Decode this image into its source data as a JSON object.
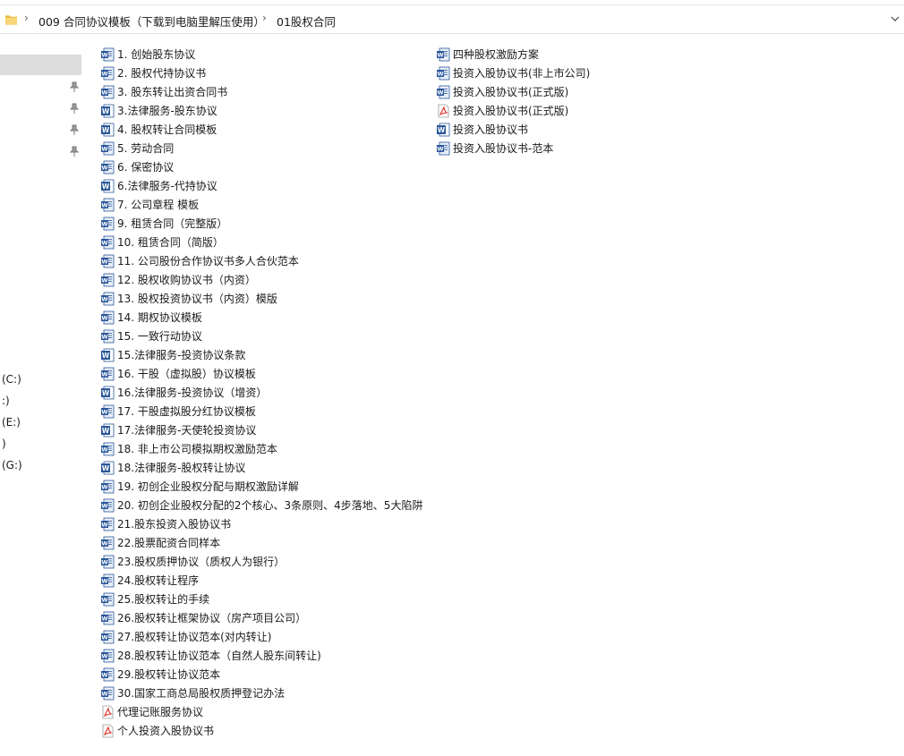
{
  "addressbar": {
    "crumbs": [
      "009 合同协议模板（下载到电脑里解压使用）",
      "01股权合同"
    ]
  },
  "navpane": {
    "drives": [
      "(C:)",
      ":)",
      "(E:)",
      ")",
      "(G:)"
    ]
  },
  "files_col1": [
    {
      "name": "1. 创始股东协议",
      "type": "doc"
    },
    {
      "name": "2. 股权代持协议书",
      "type": "doc"
    },
    {
      "name": "3. 股东转让出资合同书",
      "type": "doc"
    },
    {
      "name": "3.法律服务-股东协议",
      "type": "docx"
    },
    {
      "name": "4. 股权转让合同模板",
      "type": "docx"
    },
    {
      "name": "5. 劳动合同",
      "type": "doc"
    },
    {
      "name": "6. 保密协议",
      "type": "doc"
    },
    {
      "name": "6.法律服务-代持协议",
      "type": "docx"
    },
    {
      "name": "7. 公司章程 模板",
      "type": "doc"
    },
    {
      "name": "9. 租赁合同（完整版）",
      "type": "doc"
    },
    {
      "name": "10. 租赁合同（简版）",
      "type": "doc"
    },
    {
      "name": "11. 公司股份合作协议书多人合伙范本",
      "type": "doc"
    },
    {
      "name": "12. 股权收购协议书（内资）",
      "type": "doc"
    },
    {
      "name": "13. 股权投资协议书（内资）模版",
      "type": "doc"
    },
    {
      "name": "14. 期权协议模板",
      "type": "doc"
    },
    {
      "name": "15. 一致行动协议",
      "type": "doc"
    },
    {
      "name": "15.法律服务-投资协议条款",
      "type": "docx"
    },
    {
      "name": "16. 干股（虚拟股）协议模板",
      "type": "doc"
    },
    {
      "name": "16.法律服务-投资协议（增资）",
      "type": "docx"
    },
    {
      "name": "17. 干股虚拟股分红协议模板",
      "type": "doc"
    },
    {
      "name": "17.法律服务-天使轮投资协议",
      "type": "docx"
    },
    {
      "name": "18. 非上市公司模拟期权激励范本",
      "type": "doc"
    },
    {
      "name": "18.法律服务-股权转让协议",
      "type": "docx"
    },
    {
      "name": "19. 初创企业股权分配与期权激励详解",
      "type": "doc"
    },
    {
      "name": "20. 初创企业股权分配的2个核心、3条原则、4步落地、5大陷阱",
      "type": "doc"
    },
    {
      "name": "21.股东投资入股协议书",
      "type": "doc"
    },
    {
      "name": "22.股票配资合同样本",
      "type": "doc"
    },
    {
      "name": "23.股权质押协议（质权人为银行）",
      "type": "doc"
    },
    {
      "name": "24.股权转让程序",
      "type": "doc"
    },
    {
      "name": "25.股权转让的手续",
      "type": "doc"
    },
    {
      "name": "26.股权转让框架协议（房产项目公司）",
      "type": "doc"
    },
    {
      "name": "27.股权转让协议范本(对内转让)",
      "type": "doc"
    },
    {
      "name": "28.股权转让协议范本（自然人股东间转让)",
      "type": "doc"
    },
    {
      "name": "29.股权转让协议范本",
      "type": "doc"
    },
    {
      "name": "30.国家工商总局股权质押登记办法",
      "type": "doc"
    },
    {
      "name": "代理记账服务协议",
      "type": "pdf"
    },
    {
      "name": "个人投资入股协议书",
      "type": "pdf"
    }
  ],
  "files_col2": [
    {
      "name": "四种股权激励方案",
      "type": "doc"
    },
    {
      "name": "投资入股协议书(非上市公司)",
      "type": "doc"
    },
    {
      "name": "投资入股协议书(正式版)",
      "type": "doc"
    },
    {
      "name": "投资入股协议书(正式版)",
      "type": "pdf"
    },
    {
      "name": "投资入股协议书",
      "type": "docx"
    },
    {
      "name": "投资入股协议书-范本",
      "type": "doc"
    }
  ],
  "icons": {
    "doc": "word-document-icon",
    "docx": "word-docx-icon",
    "pdf": "pdf-document-icon",
    "folder": "folder-icon",
    "pin": "pin-icon",
    "chevron": "chevron-right-icon"
  },
  "colors": {
    "word_blue": "#2b579a",
    "word_light": "#e8eef7",
    "pdf_red": "#d93025",
    "folder_yellow": "#f8d775",
    "nav_selected": "#dcdcdc"
  }
}
